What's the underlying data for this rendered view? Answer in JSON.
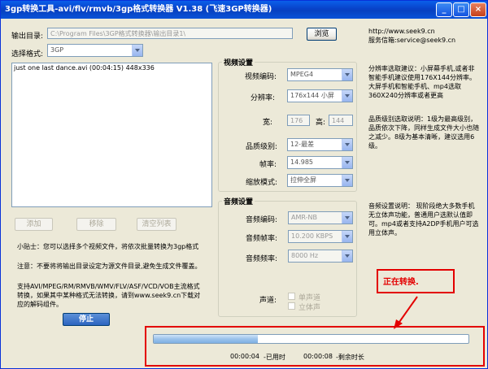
{
  "window": {
    "title": "3gp转换工具-avi/flv/rmvb/3gp格式转换器 V1.38 (飞速3GP转换器)",
    "controls": {
      "minimize": "_",
      "maximize": "□",
      "close": "×"
    }
  },
  "output": {
    "label": "输出目录:",
    "value": "C:\\Program Files\\3GP格式转换器\\输出目录1\\",
    "browse_label": "浏览"
  },
  "site": {
    "url": "http://www.seek9.cn",
    "email": "服务信箱:service@seek9.cn"
  },
  "format": {
    "label": "选择格式:",
    "value": "3GP"
  },
  "file_list": {
    "items": [
      "just one last dance.avi (00:04:15) 448x336"
    ]
  },
  "list_buttons": {
    "add": "添加",
    "remove": "移除",
    "clear": "清空列表"
  },
  "tips": {
    "tip1": "小贴士：您可以选择多个视频文件，将依次批量转换为3gp格式",
    "tip2": "注意：不要将将输出目录设定为源文件目录,避免生成文件覆盖。",
    "tip3": "支持AVI/MPEG/RM/RMVB/WMV/FLV/ASF/VCD/VOB主流格式转换，如果其中某种格式无法转换，请到www.seek9.cn下载对应的解码组件。",
    "stop_label": "停止"
  },
  "video": {
    "title": "视频设置",
    "codec_label": "视频编码:",
    "codec_value": "MPEG4",
    "res_label": "分辨率:",
    "res_value": "176x144 小屏",
    "width_label": "宽:",
    "width_value": "176",
    "height_label": "高:",
    "height_value": "144",
    "quality_label": "品质级别:",
    "quality_value": "12-最差",
    "fps_label": "帧率:",
    "fps_value": "14.985",
    "scale_label": "缩放模式:",
    "scale_value": "拉伸全屏"
  },
  "audio": {
    "title": "音频设置",
    "codec_label": "音频编码:",
    "codec_value": "AMR-NB",
    "rate_label": "音频帧率:",
    "rate_value": "10.200 KBPS",
    "freq_label": "音频频率:",
    "freq_value": "8000 Hz",
    "channel_label": "声道:",
    "mono_label": "单声道",
    "stereo_label": "立体声"
  },
  "notes": {
    "res_note": "分辨率选取建议：小屏幕手机,或者非智能手机建议使用176X144分辨率。大屏手机和智能手机、mp4选取360X240分辨率或者更高",
    "quality_note": "品质级别选取说明：1级为最高级别，品质依次下降，同样生成文件大小也随之减少。8级为基本清晰，建议选用6级。",
    "audio_note": "音频设置说明：   现阶段绝大多数手机无立体声功能，普通用户选默认值即可。mp4或者支持A2DP手机用户可选用立体声。"
  },
  "status": {
    "converting_label": "正在转换.",
    "progress": 0.33,
    "elapsed_time": "00:00:04",
    "elapsed_label": "-已用时",
    "remaining_time": "00:00:08",
    "remaining_label": "-剩余时长"
  }
}
